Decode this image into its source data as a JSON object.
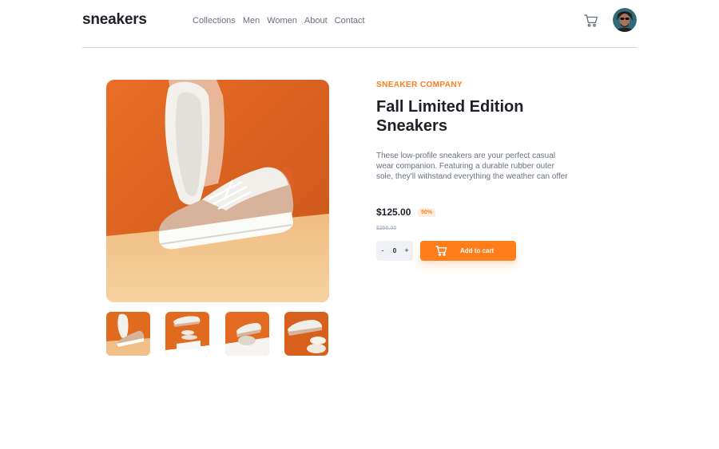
{
  "brand": {
    "logo": "sneakers"
  },
  "nav": {
    "items": [
      "Collections",
      "Men",
      "Women",
      "About",
      "Contact"
    ]
  },
  "icons": {
    "cart": "cart-icon",
    "avatar": "user-avatar"
  },
  "gallery": {
    "main_alt": "sneaker-photo",
    "thumbnails": [
      "thumbnail-1",
      "thumbnail-2",
      "thumbnail-3",
      "thumbnail-4"
    ]
  },
  "product": {
    "company": "SNEAKER COMPANY",
    "title": "Fall Limited Edition Sneakers",
    "description": "These low-profile sneakers are your perfect casual wear companion. Featuring a durable rubber outer sole, they'll withstand everything the weather can offer",
    "price": "$125.00",
    "discount": "50%",
    "original_price": "$250.00"
  },
  "cart_controls": {
    "minus": "-",
    "quantity": "0",
    "plus": "+",
    "add_label": "Add to cart"
  },
  "colors": {
    "accent": "#ff7d1a",
    "accent_pale": "#ffede0",
    "text_dark": "#1d2026",
    "text_muted": "#69707d",
    "photo_orange": "#e06a1e",
    "photo_sand": "#f2c58a"
  }
}
